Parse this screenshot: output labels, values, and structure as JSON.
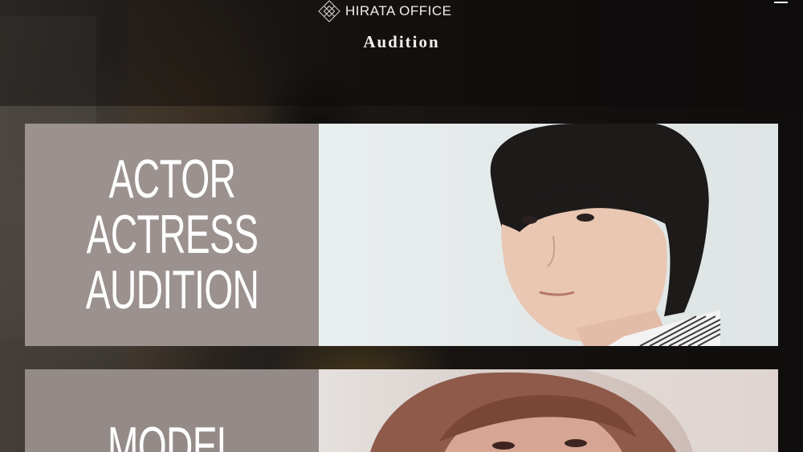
{
  "header": {
    "logo_text": "HIRATA OFFICE",
    "page_title": "Audition"
  },
  "cards": [
    {
      "lines": [
        "ACTOR",
        "ACTRESS",
        "AUDITION"
      ]
    },
    {
      "lines": [
        "MODEL"
      ]
    }
  ],
  "colors": {
    "label_panel": "#9b918f",
    "header_text": "#f4f1ec"
  },
  "icons": {
    "logo": "diamond-lattice-icon",
    "menu": "hamburger-menu-icon"
  }
}
